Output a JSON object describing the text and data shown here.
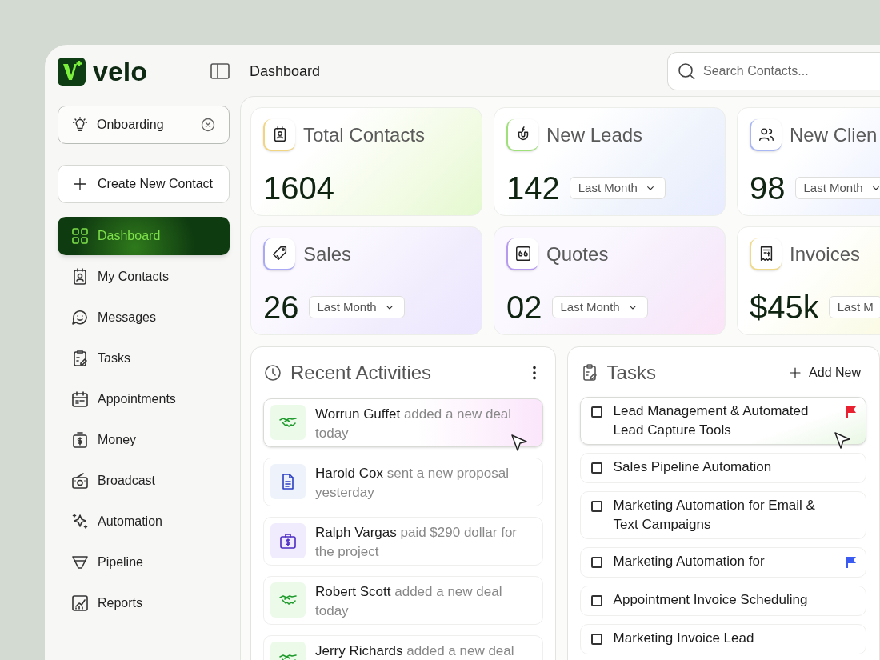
{
  "brand": {
    "name": "velo"
  },
  "header": {
    "title": "Dashboard",
    "search": {
      "placeholder": "Search Contacts..."
    }
  },
  "sidebar": {
    "onboarding": "Onboarding",
    "create_button": "Create New Contact",
    "items": [
      {
        "label": "Dashboard",
        "selected": true
      },
      {
        "label": "My Contacts",
        "selected": false
      },
      {
        "label": "Messages",
        "selected": false
      },
      {
        "label": "Tasks",
        "selected": false
      },
      {
        "label": "Appointments",
        "selected": false
      },
      {
        "label": "Money",
        "selected": false
      },
      {
        "label": "Broadcast",
        "selected": false
      },
      {
        "label": "Automation",
        "selected": false
      },
      {
        "label": "Pipeline",
        "selected": false
      },
      {
        "label": "Reports",
        "selected": false
      }
    ]
  },
  "stats": [
    {
      "title": "Total Contacts",
      "value": "1604"
    },
    {
      "title": "New Leads",
      "value": "142",
      "period": "Last Month"
    },
    {
      "title": "New Clien",
      "value": "98",
      "period": "Last Month"
    },
    {
      "title": "Sales",
      "value": "26",
      "period": "Last Month"
    },
    {
      "title": "Quotes",
      "value": "02",
      "period": "Last Month"
    },
    {
      "title": "Invoices",
      "value": "$45k",
      "period": "Last M"
    }
  ],
  "recent_activities": {
    "title": "Recent Activities",
    "items": [
      {
        "name": "Worrun Guffet",
        "detail": "added a new deal today",
        "kind": "deal",
        "hovered": true
      },
      {
        "name": "Harold Cox",
        "detail": "sent a new proposal yesterday",
        "kind": "proposal",
        "hovered": false
      },
      {
        "name": "Ralph Vargas",
        "detail": "paid $290 dollar for the project",
        "kind": "payment",
        "hovered": false
      },
      {
        "name": "Robert Scott",
        "detail": "added a new deal today",
        "kind": "deal",
        "hovered": false
      },
      {
        "name": "Jerry Richards",
        "detail": "added a new deal",
        "kind": "deal",
        "hovered": false
      }
    ]
  },
  "tasks": {
    "title": "Tasks",
    "add_label": "Add New",
    "items": [
      {
        "label": "Lead Management & Automated Lead Capture Tools",
        "checked": false,
        "color": "#e8202f",
        "hovered": true
      },
      {
        "label": "Sales Pipeline Automation",
        "checked": false,
        "hovered": false
      },
      {
        "label": "Marketing Automation for Email & Text Campaigns",
        "checked": false,
        "hovered": false
      },
      {
        "label": "Marketing Automation for",
        "checked": false,
        "color": "#3b5bf0",
        "hovered": false
      },
      {
        "label": "Appointment Invoice Scheduling",
        "checked": false,
        "hovered": false
      },
      {
        "label": "Marketing Invoice Lead",
        "checked": false,
        "hovered": false
      }
    ]
  }
}
